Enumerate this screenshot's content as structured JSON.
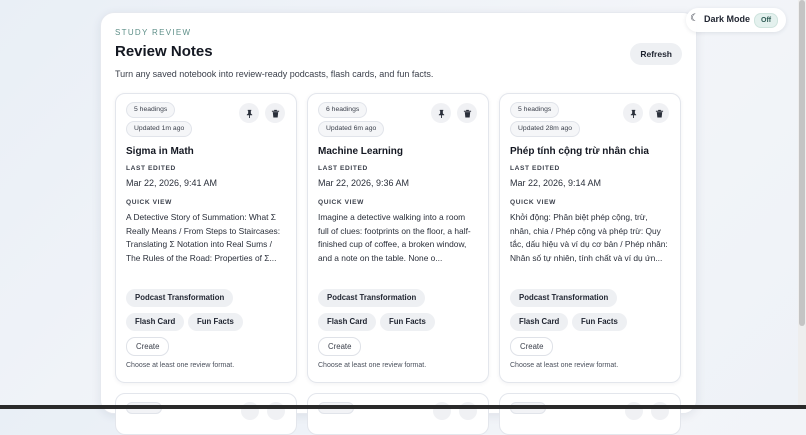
{
  "header": {
    "eyebrow": "STUDY REVIEW",
    "title": "Review Notes",
    "subtitle": "Turn any saved notebook into review-ready podcasts, flash cards, and fun facts.",
    "refresh_label": "Refresh"
  },
  "dark_mode": {
    "label": "Dark Mode",
    "state": "Off",
    "icon": "moon-icon"
  },
  "labels": {
    "last_edited": "LAST EDITED",
    "quick_view": "QUICK VIEW"
  },
  "cards": [
    {
      "headings": "5 headings",
      "updated": "Updated 1m ago",
      "title": "Sigma in Math",
      "last_edited": "Mar 22, 2026, 9:41 AM",
      "quick_view": "A Detective Story of Summation: What Σ Really Means / From Steps to Staircases: Translating Σ Notation into Real Sums / The Rules of the Road: Properties of Σ...",
      "formats": {
        "podcast": "Podcast Transformation",
        "flash": "Flash Card",
        "fun": "Fun Facts"
      },
      "create_label": "Create",
      "hint": "Choose at least one review format."
    },
    {
      "headings": "6 headings",
      "updated": "Updated 6m ago",
      "title": "Machine Learning",
      "last_edited": "Mar 22, 2026, 9:36 AM",
      "quick_view": "Imagine a detective walking into a room full of clues: footprints on the floor, a half-finished cup of coffee, a broken window, and a note on the table. None o...",
      "formats": {
        "podcast": "Podcast Transformation",
        "flash": "Flash Card",
        "fun": "Fun Facts"
      },
      "create_label": "Create",
      "hint": "Choose at least one review format."
    },
    {
      "headings": "5 headings",
      "updated": "Updated 28m ago",
      "title": "Phép tính cộng trừ nhân chia",
      "last_edited": "Mar 22, 2026, 9:14 AM",
      "quick_view": "Khởi động: Phân biệt phép cộng, trừ, nhân, chia / Phép cộng và phép trừ: Quy tắc, dấu hiệu và ví dụ cơ bản / Phép nhân: Nhân số tự nhiên, tính chất và ví dụ ứn...",
      "formats": {
        "podcast": "Podcast Transformation",
        "flash": "Flash Card",
        "fun": "Fun Facts"
      },
      "create_label": "Create",
      "hint": "Choose at least one review format."
    }
  ]
}
